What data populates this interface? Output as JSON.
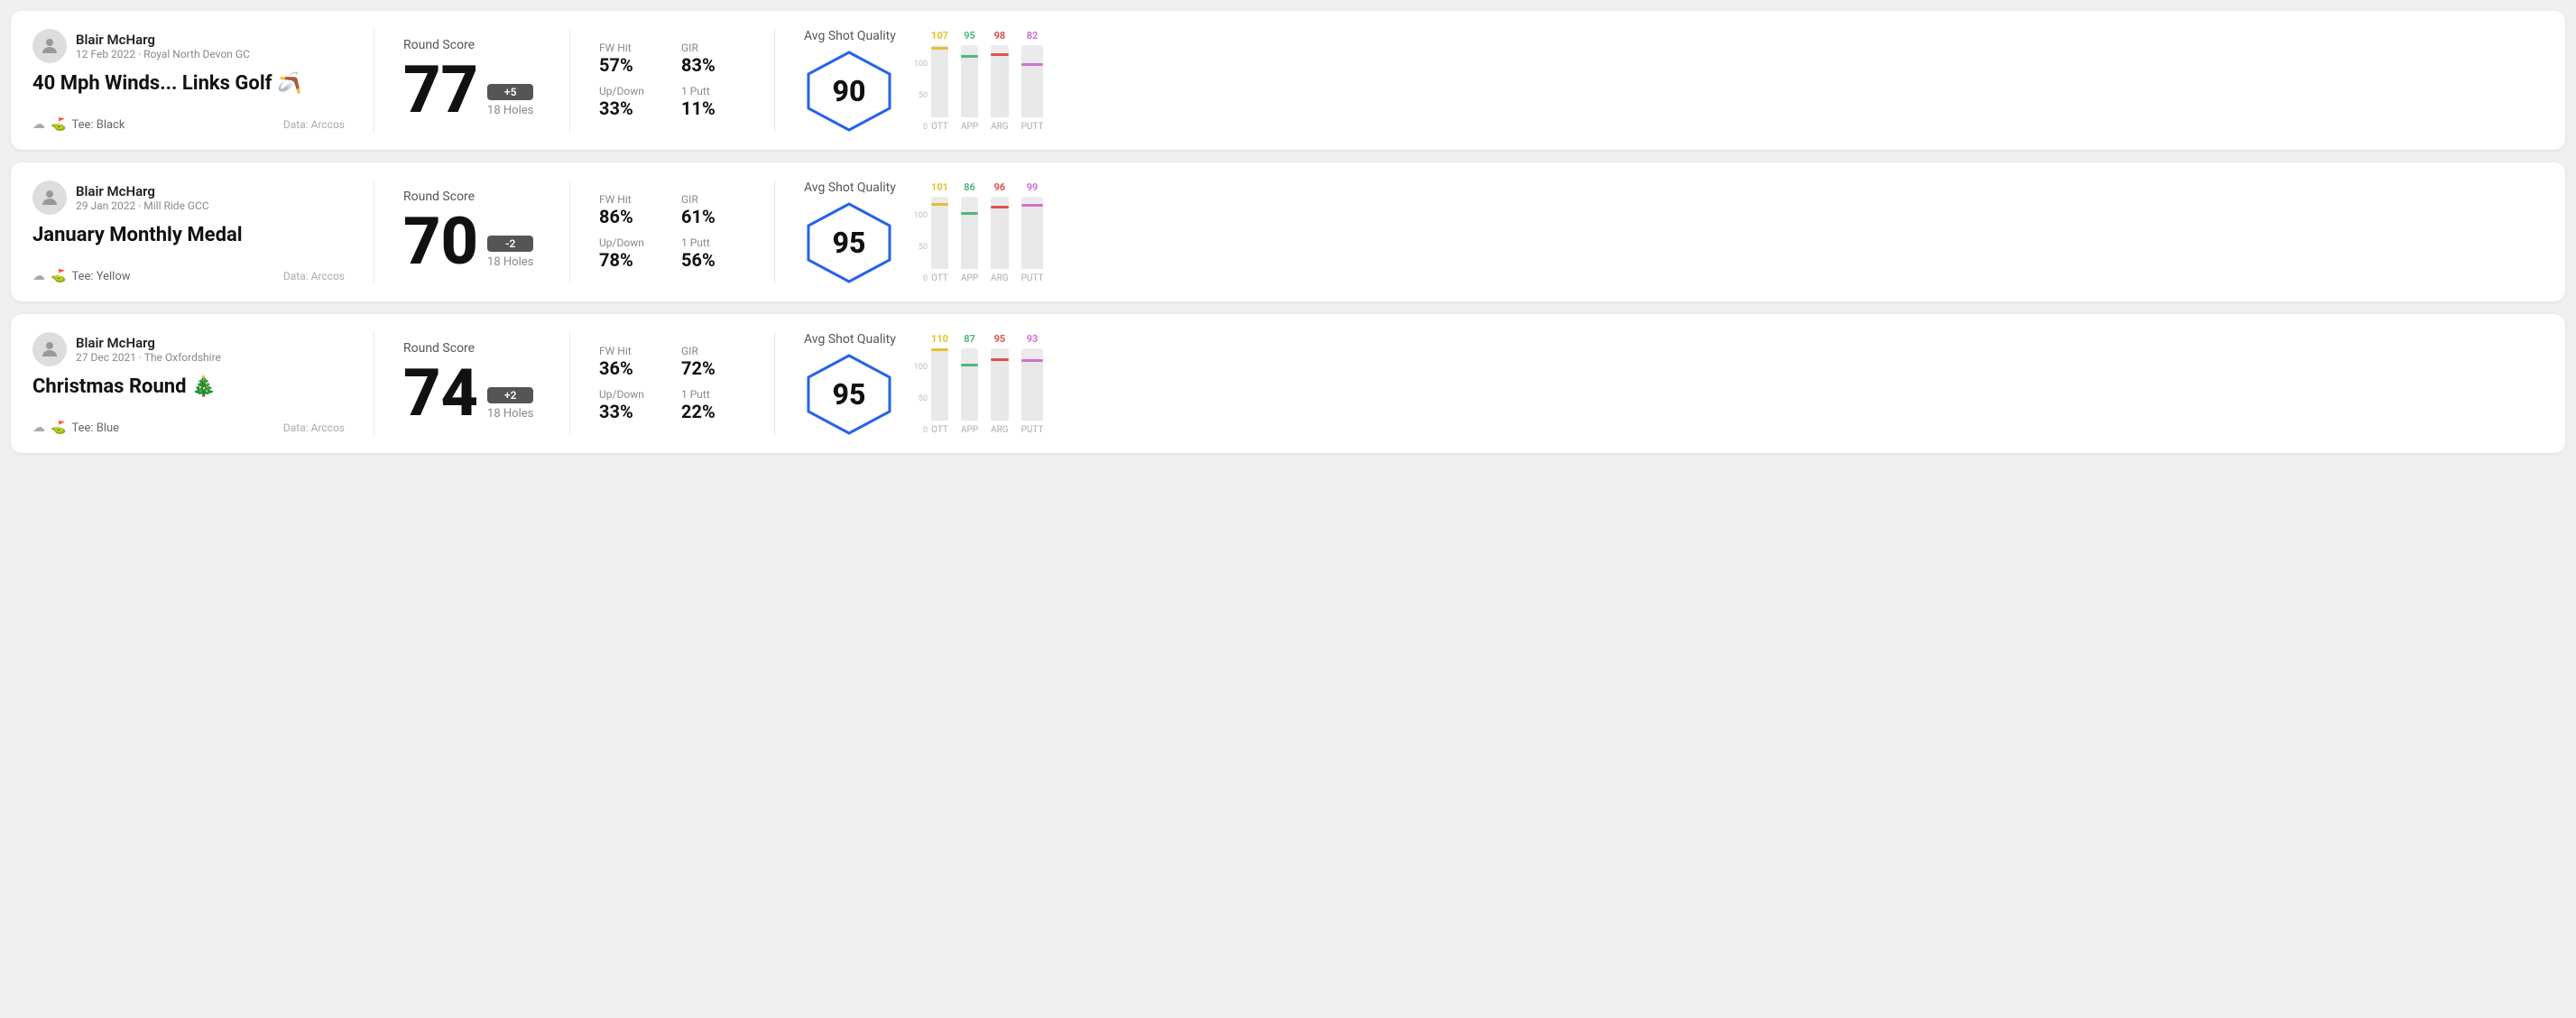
{
  "rounds": [
    {
      "id": "round-1",
      "user": {
        "name": "Blair McHarg",
        "meta": "12 Feb 2022 · Royal North Devon GC"
      },
      "title": "40 Mph Winds... Links Golf",
      "title_emoji": "🪃",
      "tee": "Black",
      "data_source": "Data: Arccos",
      "score": "77",
      "score_diff": "+5",
      "score_diff_sign": "positive",
      "holes": "18 Holes",
      "fw_hit": "57%",
      "gir": "83%",
      "up_down": "33%",
      "one_putt": "11%",
      "avg_shot_quality": "90",
      "chart": {
        "bars": [
          {
            "label": "OTT",
            "value": 107,
            "color": "#e6c030",
            "max": 110
          },
          {
            "label": "APP",
            "value": 95,
            "color": "#4db87a",
            "max": 110
          },
          {
            "label": "ARG",
            "value": 98,
            "color": "#e05050",
            "max": 110
          },
          {
            "label": "PUTT",
            "value": 82,
            "color": "#d070d0",
            "max": 110
          }
        ]
      }
    },
    {
      "id": "round-2",
      "user": {
        "name": "Blair McHarg",
        "meta": "29 Jan 2022 · Mill Ride GCC"
      },
      "title": "January Monthly Medal",
      "title_emoji": "",
      "tee": "Yellow",
      "data_source": "Data: Arccos",
      "score": "70",
      "score_diff": "-2",
      "score_diff_sign": "negative",
      "holes": "18 Holes",
      "fw_hit": "86%",
      "gir": "61%",
      "up_down": "78%",
      "one_putt": "56%",
      "avg_shot_quality": "95",
      "chart": {
        "bars": [
          {
            "label": "OTT",
            "value": 101,
            "color": "#e6c030",
            "max": 110
          },
          {
            "label": "APP",
            "value": 86,
            "color": "#4db87a",
            "max": 110
          },
          {
            "label": "ARG",
            "value": 96,
            "color": "#e05050",
            "max": 110
          },
          {
            "label": "PUTT",
            "value": 99,
            "color": "#d070d0",
            "max": 110
          }
        ]
      }
    },
    {
      "id": "round-3",
      "user": {
        "name": "Blair McHarg",
        "meta": "27 Dec 2021 · The Oxfordshire"
      },
      "title": "Christmas Round",
      "title_emoji": "🎄",
      "tee": "Blue",
      "data_source": "Data: Arccos",
      "score": "74",
      "score_diff": "+2",
      "score_diff_sign": "positive",
      "holes": "18 Holes",
      "fw_hit": "36%",
      "gir": "72%",
      "up_down": "33%",
      "one_putt": "22%",
      "avg_shot_quality": "95",
      "chart": {
        "bars": [
          {
            "label": "OTT",
            "value": 110,
            "color": "#e6c030",
            "max": 115
          },
          {
            "label": "APP",
            "value": 87,
            "color": "#4db87a",
            "max": 115
          },
          {
            "label": "ARG",
            "value": 95,
            "color": "#e05050",
            "max": 115
          },
          {
            "label": "PUTT",
            "value": 93,
            "color": "#d070d0",
            "max": 115
          }
        ]
      }
    }
  ],
  "labels": {
    "round_score": "Round Score",
    "avg_shot_quality": "Avg Shot Quality",
    "fw_hit": "FW Hit",
    "gir": "GIR",
    "up_down": "Up/Down",
    "one_putt": "1 Putt",
    "data_arccos": "Data: Arccos",
    "tee_prefix": "Tee:",
    "y_axis": [
      "100",
      "50",
      "0"
    ]
  }
}
